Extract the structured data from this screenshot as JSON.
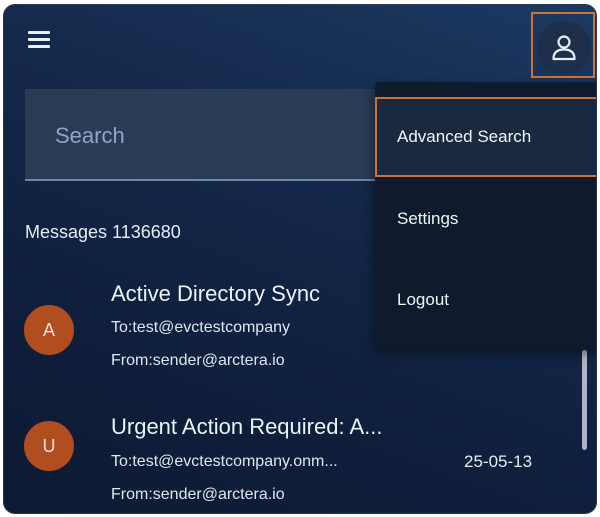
{
  "header": {
    "menu_icon": "hamburger-menu-icon",
    "user_icon": "user-icon"
  },
  "search": {
    "placeholder": "Search"
  },
  "messages": {
    "count_label": "Messages 1136680",
    "items": [
      {
        "avatar": "A",
        "subject": "Active Directory Sync",
        "to": "To:test@evctestcompany",
        "from": "From:sender@arctera.io",
        "date": ""
      },
      {
        "avatar": "U",
        "subject": "Urgent Action Required: A...",
        "to": "To:test@evctestcompany.onm...",
        "from": "From:sender@arctera.io",
        "date": "25-05-13"
      }
    ]
  },
  "user_menu": {
    "items": [
      {
        "label": "Advanced Search"
      },
      {
        "label": "Settings"
      },
      {
        "label": "Logout"
      }
    ]
  },
  "colors": {
    "accent": "#c8733a",
    "avatar": "#b04e1f",
    "background": "#14284a"
  }
}
